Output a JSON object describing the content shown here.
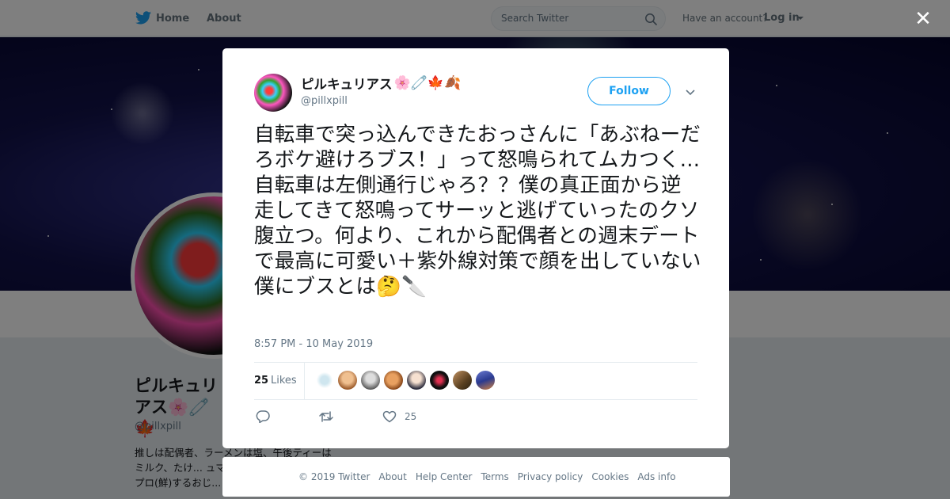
{
  "nav": {
    "home": "Home",
    "about": "About",
    "search_placeholder": "Search Twitter",
    "have_account": "Have an account?",
    "login": "Log in"
  },
  "background_profile": {
    "name": "ピルキュリアス🌸🧷🍁",
    "handle": "@pillxpill",
    "bio": "推しは配偶者、ラーメンは塩、午後ティーはミルク、たけ... ュマロ、政治や人... アカはプロ(鮮)するおじ... 決まり"
  },
  "tweet": {
    "name": "ピルキュリアス",
    "name_emojis": "🌸🧷🍁🍂",
    "handle": "@pillxpill",
    "follow_label": "Follow",
    "text": "自転車で突っ込んできたおっさんに「あぶねーだろボケ避けろブス！」って怒鳴られてムカつく…\n自転車は左側通行じゃろ？？僕の真正面から逆走してきて怒鳴ってサーッと逃げていったのクソ腹立つ。何より、これから配偶者との週末デートで最高に可愛い＋紫外線対策で顔を出していない僕にブスとは🤔🔪",
    "timestamp": "8:57 PM - 10 May 2019",
    "likes_count": "25",
    "likes_label": "Likes",
    "like_action_count": "25"
  },
  "footer": {
    "links": [
      "© 2019 Twitter",
      "About",
      "Help Center",
      "Terms",
      "Privacy policy",
      "Cookies",
      "Ads info"
    ]
  },
  "colors": {
    "accent": "#1da1f2",
    "overlay": "rgba(0,0,0,0.5)"
  },
  "icons": [
    "twitter-bird-icon",
    "search-icon",
    "close-icon",
    "chevron-down-icon",
    "reply-icon",
    "retweet-icon",
    "heart-icon"
  ]
}
